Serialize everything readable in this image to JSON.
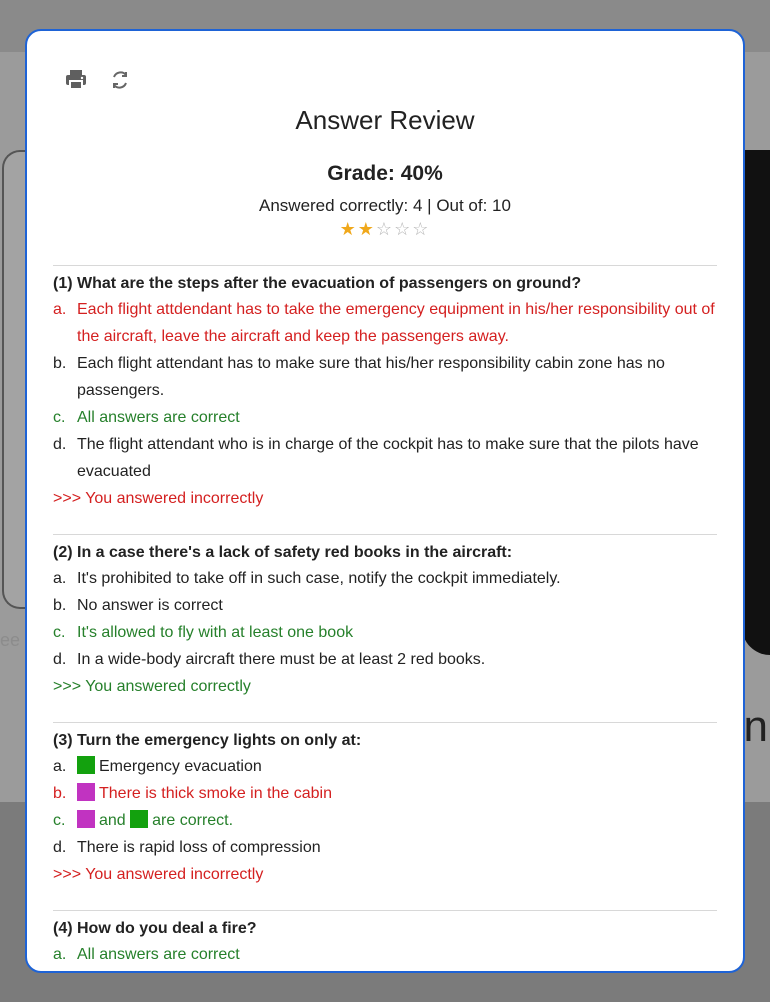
{
  "background": {
    "left_text": "ee",
    "right_text": "n"
  },
  "modal": {
    "title": "Answer Review",
    "grade": "Grade: 40%",
    "summary": "Answered correctly: 4 | Out of: 10",
    "rating": 2,
    "max_rating": 5,
    "toolbar": {
      "print_icon": "print-icon",
      "refresh_icon": "refresh-icon"
    }
  },
  "questions": [
    {
      "prompt": "(1) What are the steps after the evacuation of passengers on ground?",
      "answers": [
        {
          "letter": "a.",
          "text": "Each flight attdendant has to take the emergency equipment in his/her responsibility out of the aircraft, leave the aircraft and keep the passengers away."
        },
        {
          "letter": "b.",
          "text": "Each flight attendant has to make sure that his/her responsibility cabin zone has no passengers."
        },
        {
          "letter": "c.",
          "text": "All answers are correct"
        },
        {
          "letter": "d.",
          "text": "The flight attendant who is in charge of the cockpit has to make sure that the pilots have evacuated"
        }
      ],
      "result": ">>> You answered incorrectly"
    },
    {
      "prompt": "(2) In a case there's a lack of safety red books in the aircraft:",
      "answers": [
        {
          "letter": "a.",
          "text": "It's prohibited to take off in such case, notify the cockpit immediately."
        },
        {
          "letter": "b.",
          "text": "No answer is correct"
        },
        {
          "letter": "c.",
          "text": "It's allowed to fly with at least one book"
        },
        {
          "letter": "d.",
          "text": "In a wide-body aircraft there must be at least 2 red books."
        }
      ],
      "result": ">>> You answered correctly"
    },
    {
      "prompt": "(3) Turn the emergency lights on only at:",
      "answers": [
        {
          "letter": "a.",
          "text": "Emergency evacuation"
        },
        {
          "letter": "b.",
          "text": "There is thick smoke in the cabin"
        },
        {
          "letter": "c.",
          "text_1": "and",
          "text_2": "are correct."
        },
        {
          "letter": "d.",
          "text": "There is rapid loss of compression"
        }
      ],
      "result": ">>> You answered incorrectly"
    },
    {
      "prompt": "(4) How do you deal a fire?",
      "answers": [
        {
          "letter": "a.",
          "text": "All answers are correct"
        }
      ]
    }
  ],
  "colors": {
    "correct": "#26802b",
    "incorrect": "#d42020",
    "accent": "#1e63d6",
    "star": "#f0a81b"
  }
}
